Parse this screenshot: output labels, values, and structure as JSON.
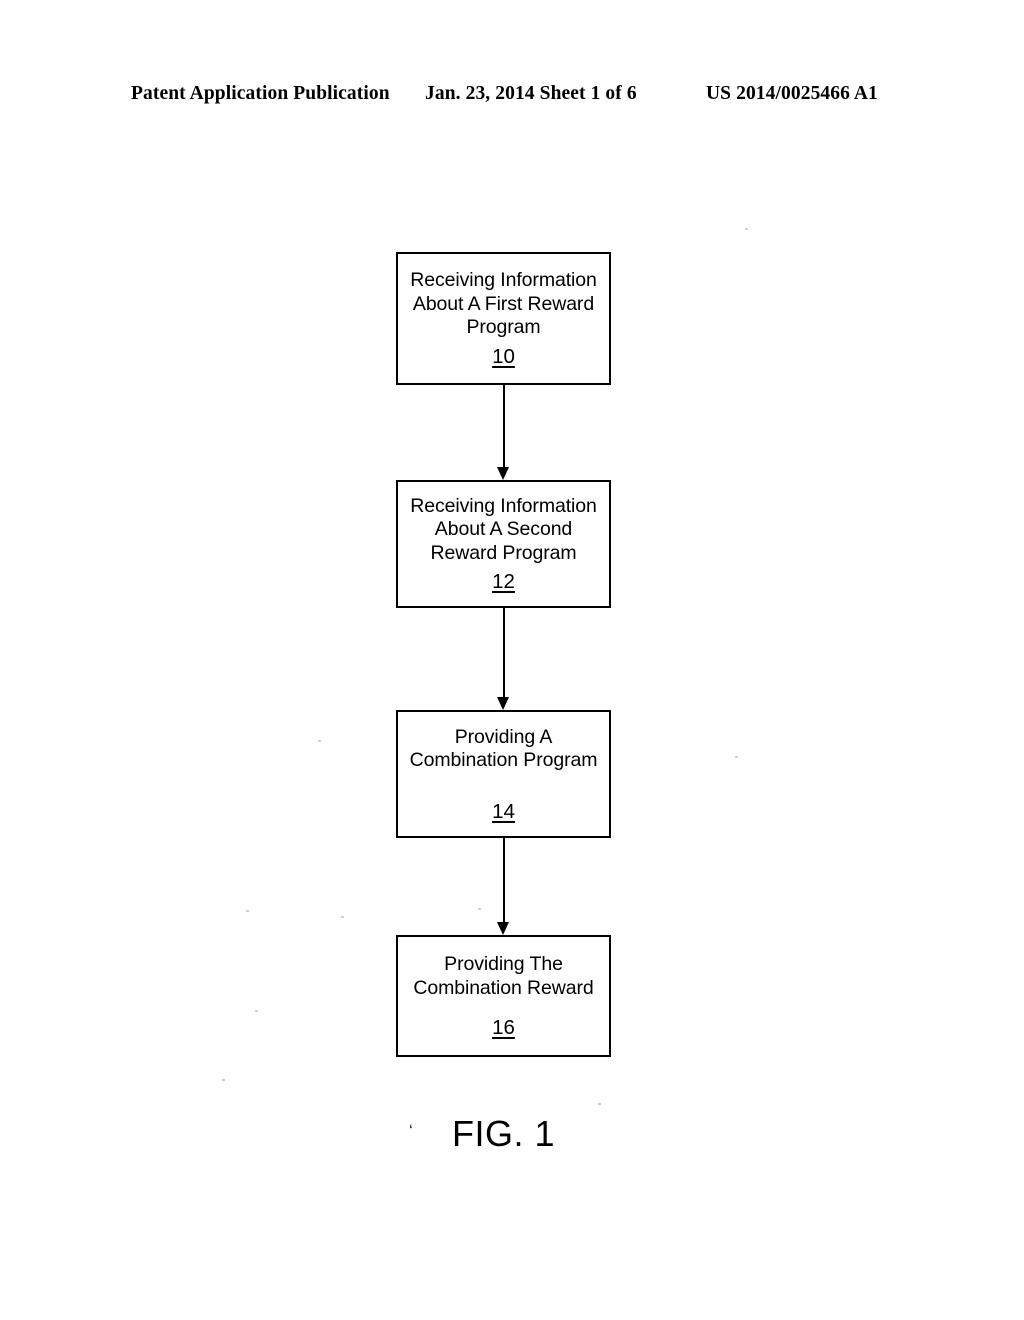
{
  "header": {
    "left": "Patent Application Publication",
    "center": "Jan. 23, 2014  Sheet 1 of 6",
    "right": "US 2014/0025466 A1"
  },
  "figure": {
    "caption": "FIG. 1",
    "stray_mark": "‘",
    "boxes": [
      {
        "id": "10",
        "text": "Receiving Information\nAbout A First Reward\nProgram",
        "ref": "10"
      },
      {
        "id": "12",
        "text": "Receiving Information\nAbout A Second\nReward Program",
        "ref": "12"
      },
      {
        "id": "14",
        "text": "Providing A\nCombination Program",
        "ref": "14"
      },
      {
        "id": "16",
        "text": "Providing The\nCombination Reward",
        "ref": "16"
      }
    ],
    "connectors": [
      {
        "from": "10",
        "to": "12"
      },
      {
        "from": "12",
        "to": "14"
      },
      {
        "from": "14",
        "to": "16"
      }
    ]
  },
  "colors": {
    "ink": "#000000",
    "page": "#ffffff"
  }
}
